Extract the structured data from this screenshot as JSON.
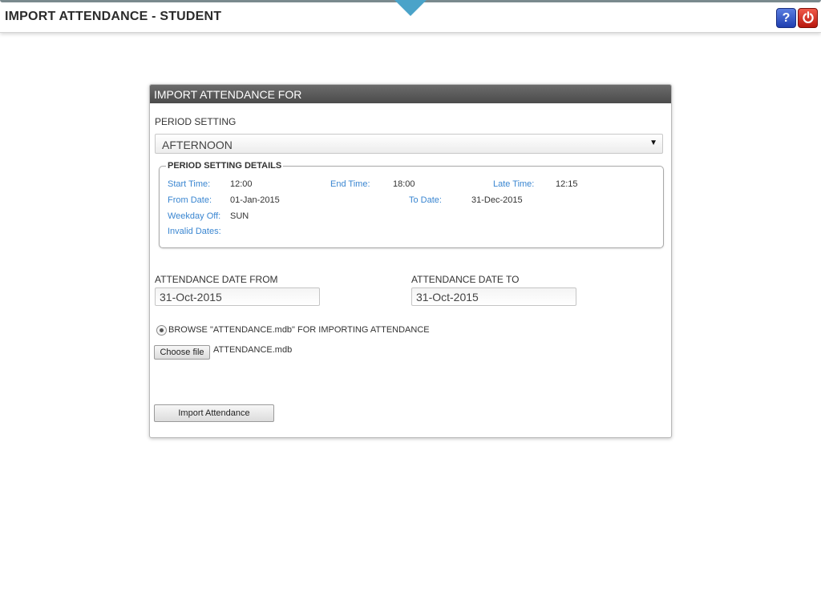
{
  "header": {
    "title": "IMPORT ATTENDANCE - STUDENT",
    "help_label": "?"
  },
  "panel": {
    "title": "IMPORT ATTENDANCE FOR",
    "period_setting_label": "PERIOD SETTING",
    "period_setting_value": "AFTERNOON",
    "details": {
      "legend": "PERIOD SETTING DETAILS",
      "start_time_label": "Start Time:",
      "start_time_value": "12:00",
      "end_time_label": "End Time:",
      "end_time_value": "18:00",
      "late_time_label": "Late Time:",
      "late_time_value": "12:15",
      "from_date_label": "From Date:",
      "from_date_value": "01-Jan-2015",
      "to_date_label": "To Date:",
      "to_date_value": "31-Dec-2015",
      "weekday_off_label": "Weekday Off:",
      "weekday_off_value": "SUN",
      "invalid_dates_label": "Invalid Dates:"
    },
    "date_from_label": "ATTENDANCE DATE FROM",
    "date_from_value": "31-Oct-2015",
    "date_to_label": "ATTENDANCE DATE TO",
    "date_to_value": "31-Oct-2015",
    "browse_label": "BROWSE \"ATTENDANCE.mdb\" FOR IMPORTING ATTENDANCE",
    "choose_file_label": "Choose file",
    "chosen_file_name": "ATTENDANCE.mdb",
    "import_button_label": "Import Attendance"
  },
  "colors": {
    "panel_header": "#595959",
    "detail_label": "#3a86d1",
    "help_button": "#2a4cc4",
    "power_button": "#d62a1c",
    "notch": "#4aa3c9"
  },
  "icons": {
    "help": "question-mark-icon",
    "power": "power-icon",
    "dropdown": "caret-down-icon"
  }
}
